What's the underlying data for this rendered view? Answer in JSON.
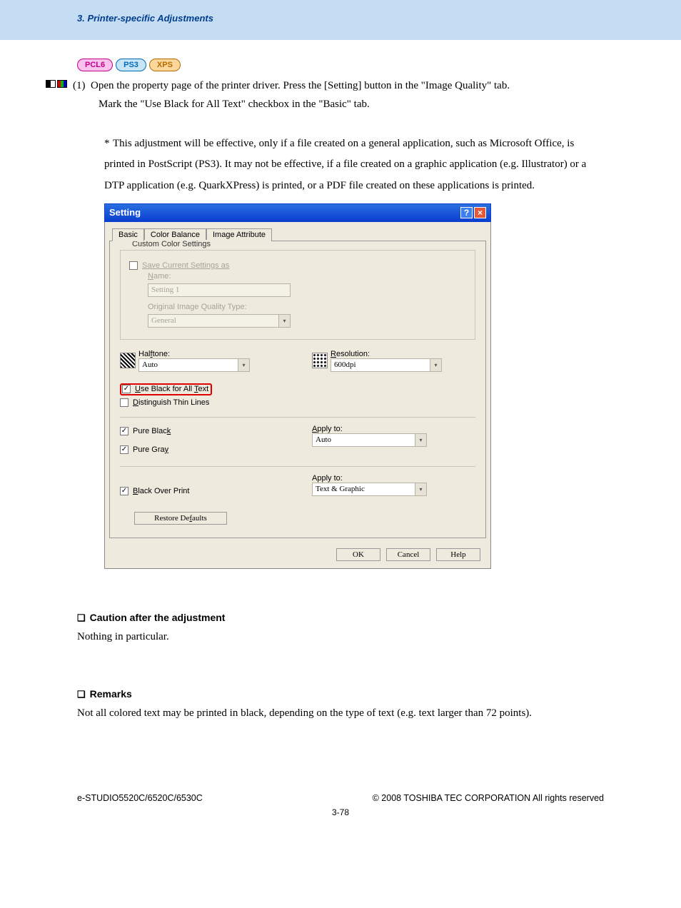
{
  "header": {
    "section_title": "3. Printer-specific Adjustments"
  },
  "chips": {
    "pcl6": "PCL6",
    "ps3": "PS3",
    "xps": "XPS"
  },
  "step": {
    "num": "(1)",
    "text1": "Open the property page of the printer driver.  Press the [Setting] button in the \"Image Quality\" tab.",
    "text2": "Mark the \"Use Black for All Text\" checkbox in the \"Basic\" tab."
  },
  "note": "This adjustment will be effective, only if a file created on a general application, such as Microsoft Office, is printed in PostScript (PS3).  It may not be effective, if a file created on a graphic application (e.g. Illustrator) or a DTP application (e.g. QuarkXPress) is printed, or a PDF file created on these applications is printed.",
  "dialog": {
    "title": "Setting",
    "tabs": {
      "basic": "Basic",
      "color_balance": "Color Balance",
      "image_attribute": "Image Attribute"
    },
    "custom": {
      "title": "Custom Color Settings",
      "save_as": "Save Current Settings as",
      "name_label": "Name:",
      "name_value": "Setting 1",
      "oiq_label": "Original Image Quality Type:",
      "oiq_value": "General"
    },
    "halftone": {
      "label": "Halftone:",
      "value": "Auto"
    },
    "resolution": {
      "label": "Resolution:",
      "value": "600dpi"
    },
    "cb_use_black": "Use Black for All Text",
    "cb_thin_lines": "Distinguish Thin Lines",
    "cb_pure_black": "Pure Black",
    "cb_pure_gray": "Pure Gray",
    "apply1": {
      "label": "Apply to:",
      "value": "Auto"
    },
    "cb_bop": "Black Over Print",
    "apply2": {
      "label": "Apply to:",
      "value": "Text & Graphic"
    },
    "restore": "Restore Defaults",
    "ok": "OK",
    "cancel": "Cancel",
    "help": "Help"
  },
  "caution": {
    "heading": "Caution after the adjustment",
    "body": "Nothing in particular."
  },
  "remarks": {
    "heading": "Remarks",
    "body": "Not all colored text may be printed in black, depending on the type of text (e.g. text larger than 72 points)."
  },
  "footer": {
    "left": "e-STUDIO5520C/6520C/6530C",
    "right": "© 2008 TOSHIBA TEC CORPORATION All rights reserved",
    "page": "3-78"
  }
}
